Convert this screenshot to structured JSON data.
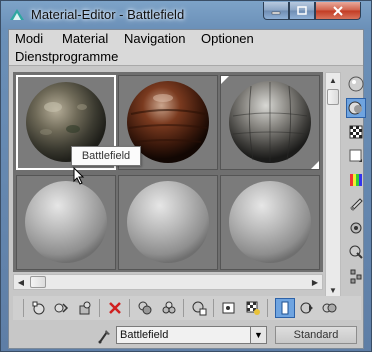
{
  "window": {
    "title": "Material-Editor - Battlefield"
  },
  "menu": {
    "items": [
      "Modi",
      "Material",
      "Navigation",
      "Optionen",
      "Dienstprogramme"
    ]
  },
  "slots": {
    "tooltip": "Battlefield",
    "items": [
      {
        "material": "battlefield-terrain",
        "active": true
      },
      {
        "material": "rusty-metal",
        "active": false
      },
      {
        "material": "cracked-stone",
        "active": false
      },
      {
        "material": "default-gray",
        "active": false
      },
      {
        "material": "default-gray",
        "active": false
      },
      {
        "material": "default-gray",
        "active": false
      }
    ]
  },
  "right_toolbar": {
    "items": [
      "sample-type-sphere-icon",
      "backlight-icon",
      "background-checker-icon",
      "sample-uv-tiling-icon",
      "video-color-check-icon",
      "make-preview-icon",
      "options-icon",
      "select-by-material-icon",
      "material-map-navigator-icon"
    ]
  },
  "bottom_toolbar": {
    "items": [
      "get-material-icon",
      "put-to-scene-icon",
      "assign-to-selection-icon",
      "reset-map-icon",
      "make-unique-icon",
      "put-to-library-icon",
      "material-id-channel-icon",
      "show-map-in-viewport-icon",
      "show-end-result-icon",
      "go-to-parent-icon",
      "go-forward-icon"
    ]
  },
  "material": {
    "name": "Battlefield",
    "type_button": "Standard"
  },
  "colors": {
    "pressed": "#6fa4e0",
    "close": "#c23b22"
  }
}
